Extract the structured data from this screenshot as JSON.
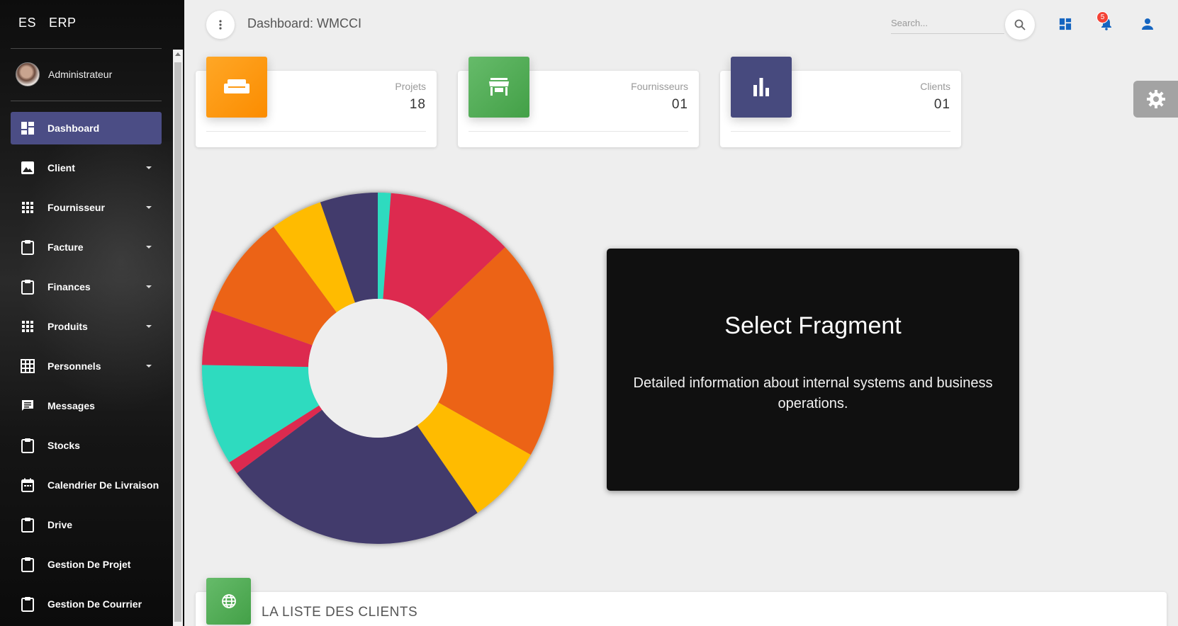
{
  "brand": {
    "part1": "ES",
    "part2": "ERP"
  },
  "user": {
    "name": "Administrateur"
  },
  "nav": [
    {
      "label": "Dashboard",
      "icon": "dashboard-icon",
      "caret": false,
      "active": true
    },
    {
      "label": "Client",
      "icon": "image-icon",
      "caret": true
    },
    {
      "label": "Fournisseur",
      "icon": "apps-grid-icon",
      "caret": true
    },
    {
      "label": "Facture",
      "icon": "clipboard-icon",
      "caret": true
    },
    {
      "label": "Finances",
      "icon": "clipboard-icon",
      "caret": true
    },
    {
      "label": "Produits",
      "icon": "apps-grid-icon",
      "caret": true
    },
    {
      "label": "Personnels",
      "icon": "grid-on-icon",
      "caret": true
    },
    {
      "label": "Messages",
      "icon": "message-icon",
      "caret": false
    },
    {
      "label": "Stocks",
      "icon": "clipboard-icon",
      "caret": false
    },
    {
      "label": "Calendrier De Livraison",
      "icon": "calendar-icon",
      "caret": false
    },
    {
      "label": "Drive",
      "icon": "clipboard-icon",
      "caret": false
    },
    {
      "label": "Gestion De Projet",
      "icon": "clipboard-icon",
      "caret": false
    },
    {
      "label": "Gestion De Courrier",
      "icon": "clipboard-icon",
      "caret": false
    }
  ],
  "header": {
    "title": "Dashboard: WMCCI",
    "search_placeholder": "Search...",
    "notification_count": "5"
  },
  "cards": [
    {
      "label": "Projets",
      "value": "18",
      "icon": "weekend-icon",
      "color": "#fb8c00"
    },
    {
      "label": "Fournisseurs",
      "value": "01",
      "icon": "store-icon",
      "color": "#4caf50"
    },
    {
      "label": "Clients",
      "value": "01",
      "icon": "bar-chart-icon",
      "color": "#474a7e"
    }
  ],
  "chart_data": {
    "type": "pie",
    "variant": "donut",
    "values": [
      1.2,
      11.7,
      20.3,
      7.2,
      24.4,
      1.2,
      9.3,
      5.1,
      9.5,
      4.8,
      5.3
    ],
    "colors": [
      "#2ddbbf",
      "#dd2a4f",
      "#ec6417",
      "#ffbb00",
      "#433a6c",
      "#dd2a4f",
      "#2ddbbf",
      "#dd2a4f",
      "#ec6417",
      "#ffbb00",
      "#433a6c"
    ]
  },
  "fragment": {
    "title": "Select Fragment",
    "text": "Detailed information about internal systems and business operations."
  },
  "client_list": {
    "title": "LA LISTE DES CLIENTS"
  }
}
